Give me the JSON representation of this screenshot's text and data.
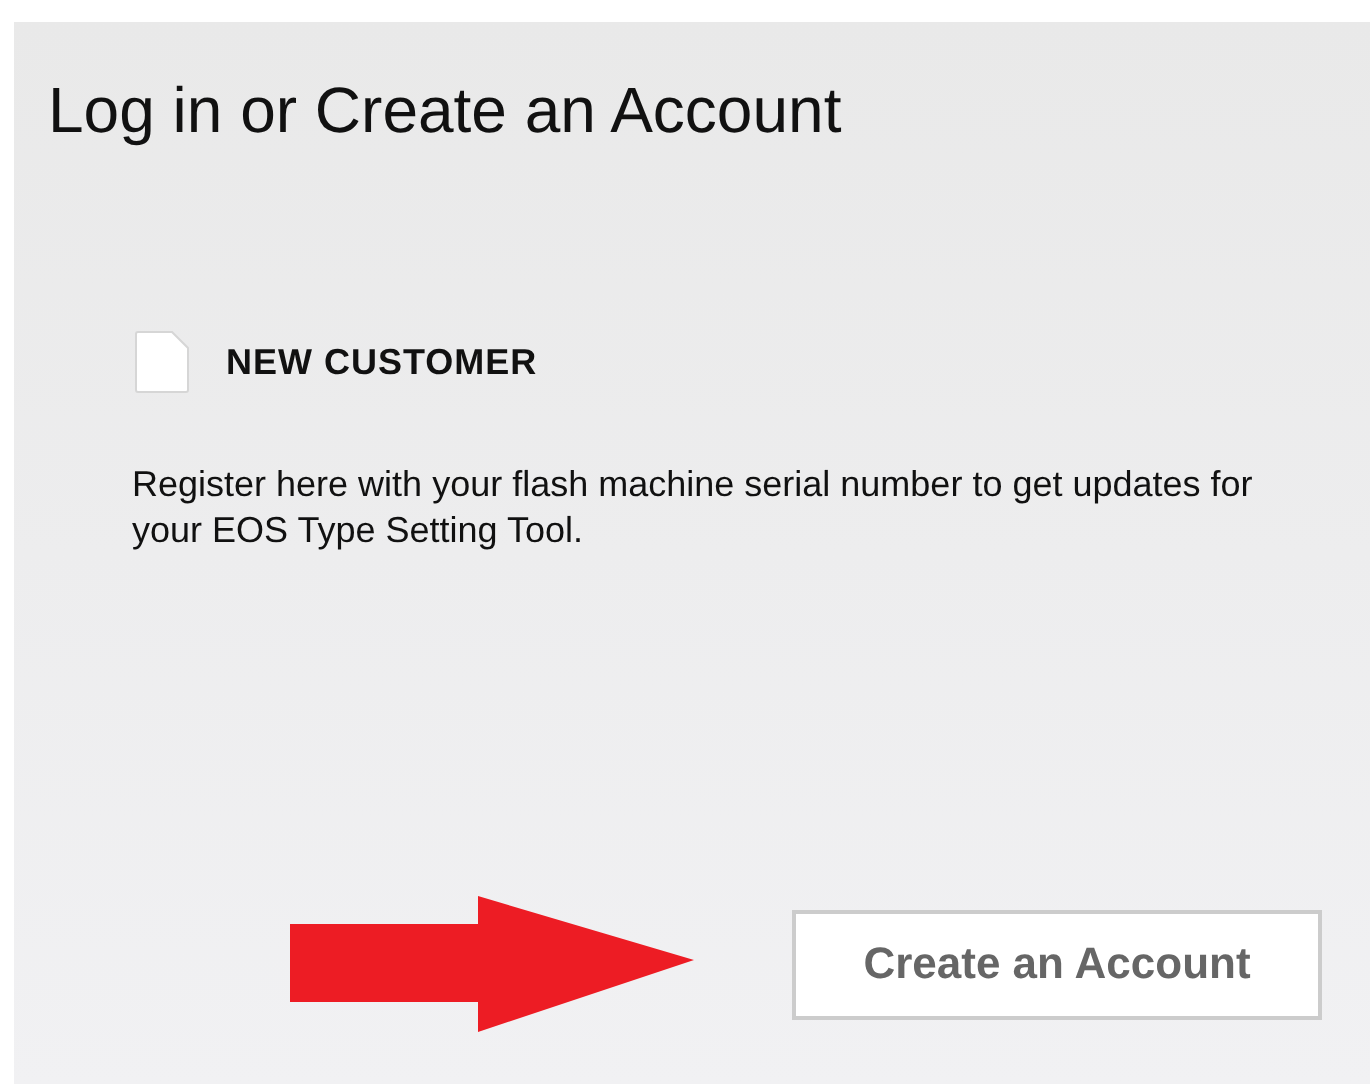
{
  "title": "Log in or Create an Account",
  "section": {
    "heading": "NEW CUSTOMER",
    "description": "Register here with your flash machine serial number to get updates for your EOS Type Setting Tool."
  },
  "button": {
    "label": "Create an Account"
  }
}
